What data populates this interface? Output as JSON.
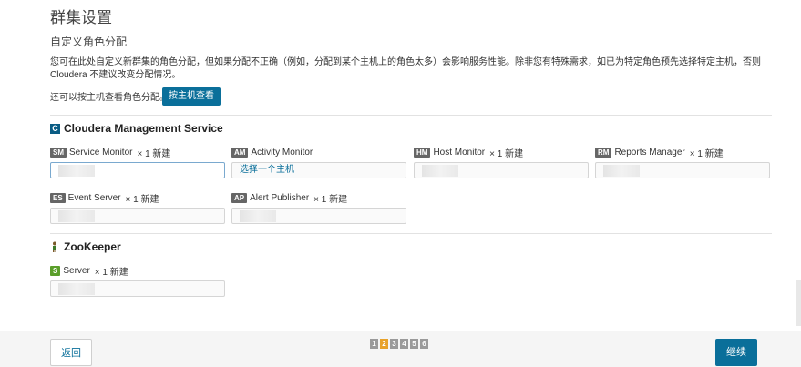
{
  "page": {
    "title": "群集设置",
    "subtitle": "自定义角色分配",
    "description": "您可在此处自定义新群集的角色分配，但如果分配不正确（例如，分配到某个主机上的角色太多）会影响服务性能。除非您有特殊需求，如已为特定角色预先选择特定主机，否则 Cloudera 不建议改变分配情况。",
    "host_view_text": "还可以按主机查看角色分配。",
    "host_view_button": "按主机查看"
  },
  "services": [
    {
      "name": "Cloudera Management Service",
      "icon": "cloudera-icon",
      "roles": [
        {
          "badge": "SM",
          "name": "Service Monitor",
          "meta": "× 1 新建",
          "input": ""
        },
        {
          "badge": "AM",
          "name": "Activity Monitor",
          "meta": "",
          "input": "选择一个主机"
        },
        {
          "badge": "HM",
          "name": "Host Monitor",
          "meta": "× 1 新建",
          "input": ""
        },
        {
          "badge": "RM",
          "name": "Reports Manager",
          "meta": "× 1 新建",
          "input": ""
        },
        {
          "badge": "ES",
          "name": "Event Server",
          "meta": "× 1 新建",
          "input": ""
        },
        {
          "badge": "AP",
          "name": "Alert Publisher",
          "meta": "× 1 新建",
          "input": ""
        }
      ]
    },
    {
      "name": "ZooKeeper",
      "icon": "zookeeper-icon",
      "roles": [
        {
          "badge": "S",
          "name": "Server",
          "meta": "× 1 新建",
          "input": ""
        }
      ]
    }
  ],
  "footer": {
    "back_label": "返回",
    "next_label": "继续",
    "steps": [
      "1",
      "2",
      "3",
      "4",
      "5",
      "6"
    ],
    "current_step": 2
  },
  "colors": {
    "primary": "#0a6f9a",
    "step_current": "#e8a22a",
    "step_default": "#9a9a9a",
    "badge_green": "#5a9e2a"
  }
}
